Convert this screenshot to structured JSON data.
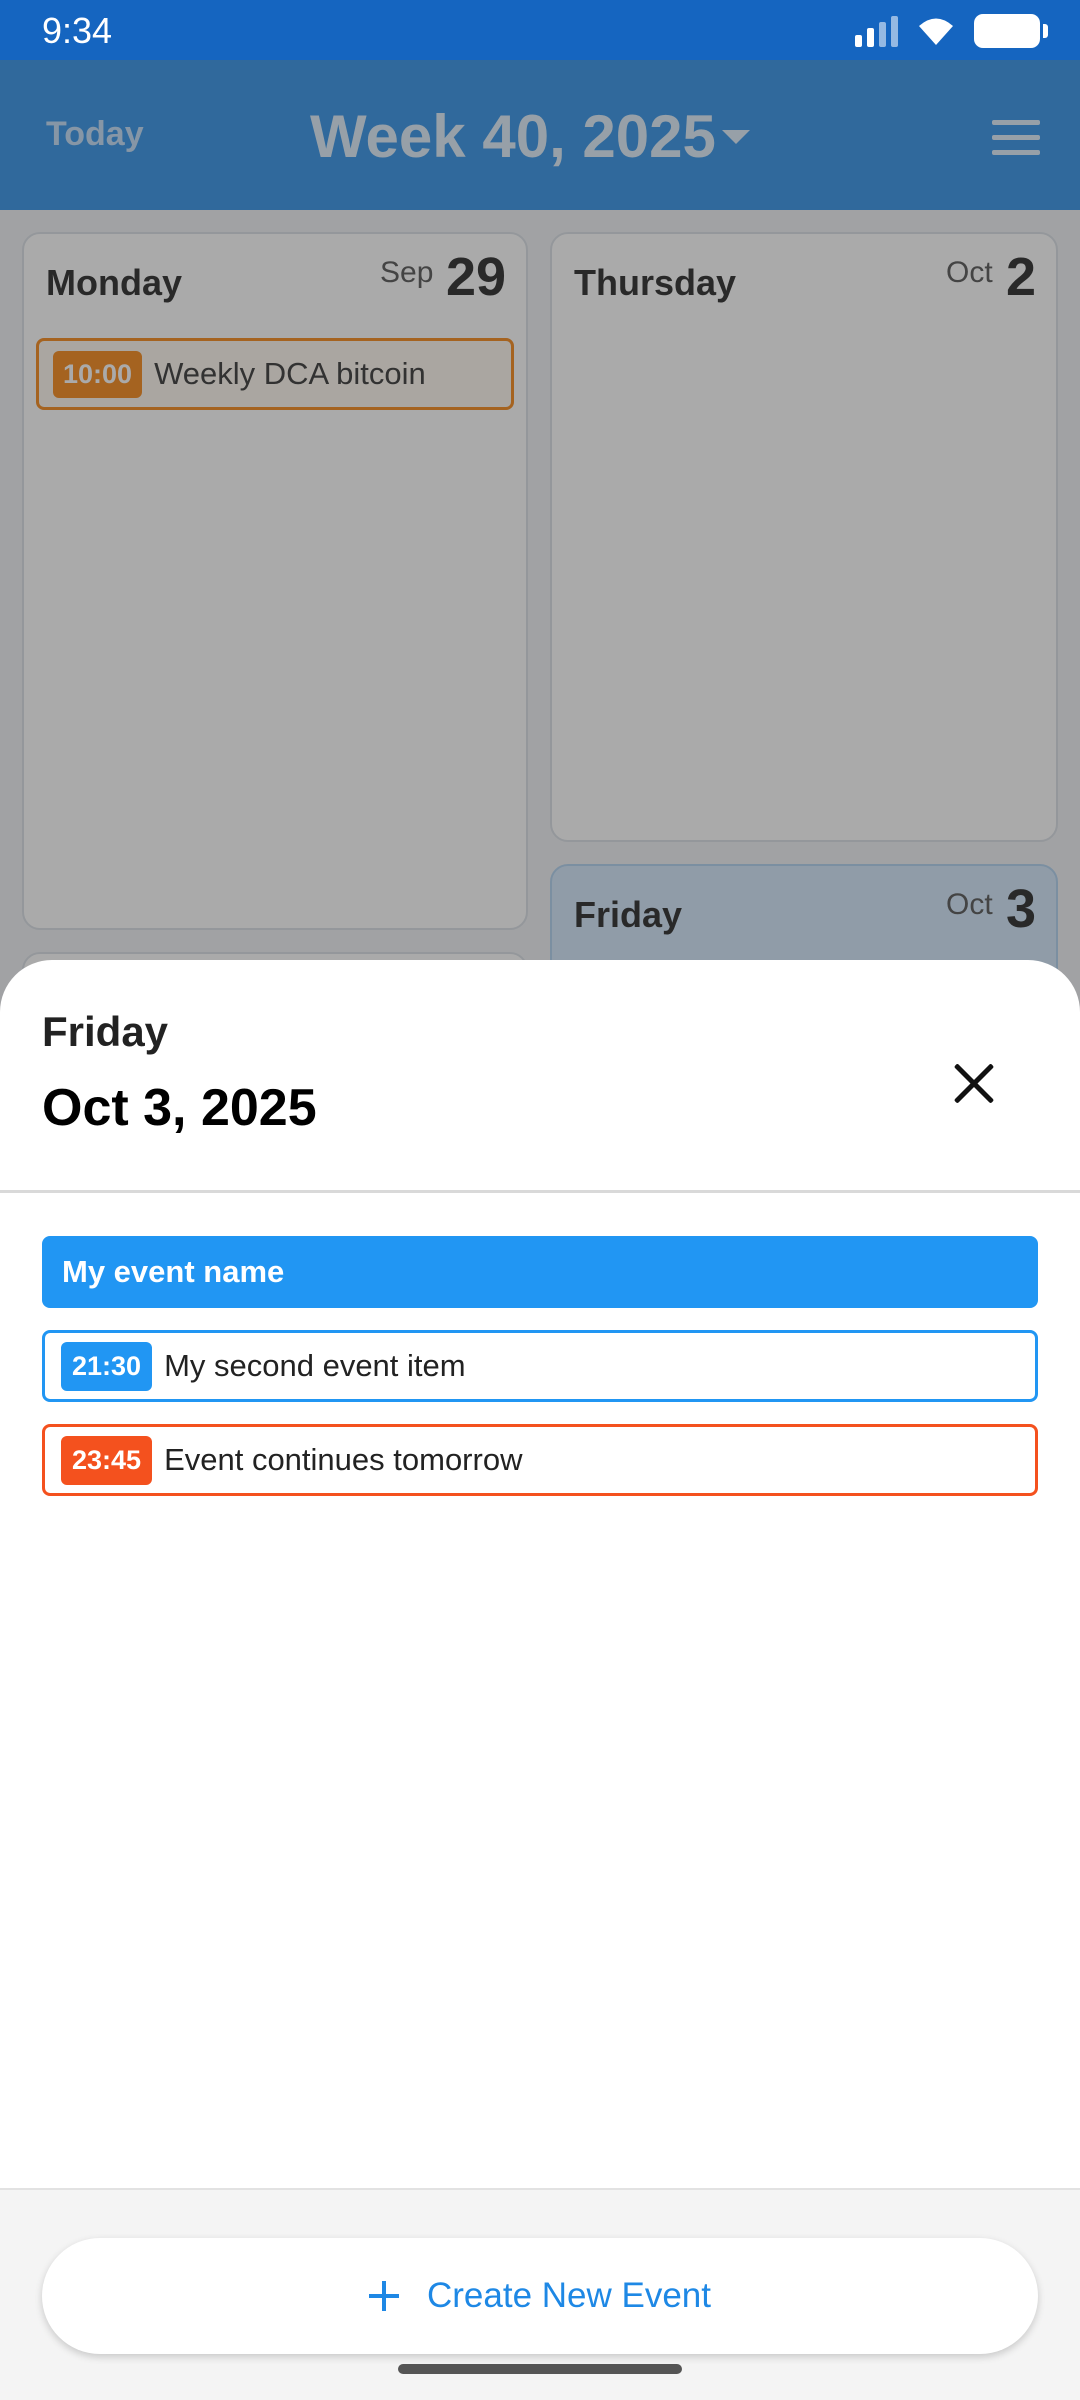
{
  "status_bar": {
    "time": "9:34"
  },
  "app_bar": {
    "today_label": "Today",
    "week_title": "Week 40, 2025"
  },
  "calendar": {
    "days": [
      {
        "name": "Monday",
        "month": "Sep",
        "day": "29",
        "events": [
          {
            "time": "10:00",
            "title": "Weekly DCA bitcoin"
          }
        ]
      },
      {
        "name": "Thursday",
        "month": "Oct",
        "day": "2",
        "events": []
      },
      {
        "name": "Friday",
        "month": "Oct",
        "day": "3",
        "events": []
      }
    ]
  },
  "sheet": {
    "weekday": "Friday",
    "date": "Oct 3, 2025",
    "events": [
      {
        "title": "My event name",
        "all_day": true,
        "color": "#2196f3"
      },
      {
        "time": "21:30",
        "title": "My second event item",
        "color": "#2196f3"
      },
      {
        "time": "23:45",
        "title": "Event continues tomorrow",
        "color": "#f4511e"
      }
    ],
    "create_button_label": "Create New Event"
  },
  "colors": {
    "primary": "#1e88e5",
    "event_orange": "#f57c00",
    "event_red_orange": "#f4511e",
    "event_blue": "#2196f3"
  }
}
